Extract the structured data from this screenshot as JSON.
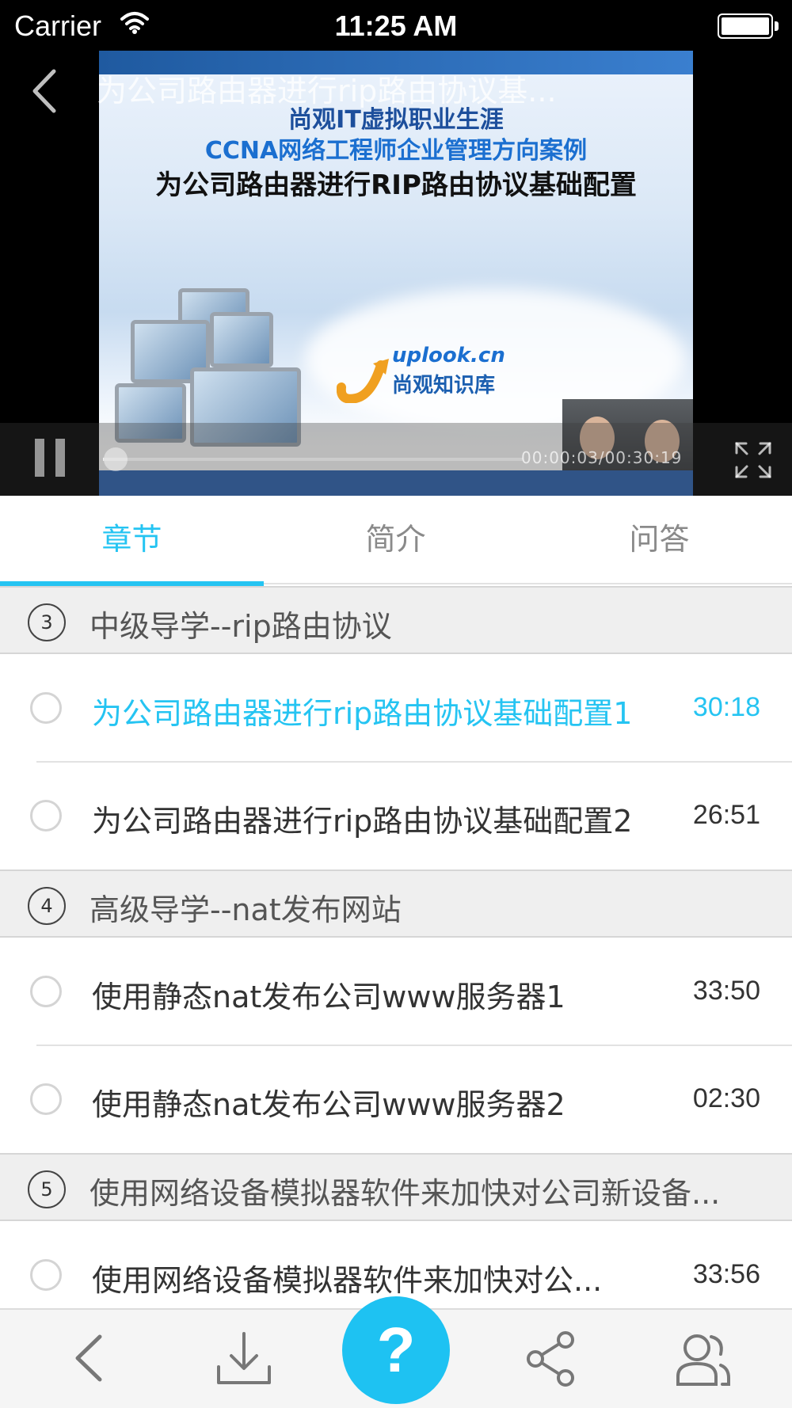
{
  "status_bar": {
    "carrier": "Carrier",
    "time": "11:25 AM"
  },
  "player": {
    "title": "为公司路由器进行rip路由协议基...",
    "frame": {
      "line1": "尚观IT虚拟职业生涯",
      "line2": "CCNA网络工程师企业管理方向案例",
      "line3": "为公司路由器进行RIP路由协议基础配置",
      "logo_line1": "uplook.cn",
      "logo_line2": "尚观知识库"
    },
    "time_display": "00:00:03/00:30:19",
    "progress_fraction": 0.002
  },
  "tabs": [
    {
      "label": "章节",
      "active": true
    },
    {
      "label": "简介",
      "active": false
    },
    {
      "label": "问答",
      "active": false
    }
  ],
  "sections": [
    {
      "number": "3",
      "title": "中级导学--rip路由协议",
      "lessons": [
        {
          "title": "为公司路由器进行rip路由协议基础配置1",
          "duration": "30:18",
          "active": true
        },
        {
          "title": "为公司路由器进行rip路由协议基础配置2",
          "duration": "26:51",
          "active": false
        }
      ]
    },
    {
      "number": "4",
      "title": "高级导学--nat发布网站",
      "lessons": [
        {
          "title": "使用静态nat发布公司www服务器1",
          "duration": "33:50",
          "active": false
        },
        {
          "title": "使用静态nat发布公司www服务器2",
          "duration": "02:30",
          "active": false
        }
      ]
    },
    {
      "number": "5",
      "title": "使用网络设备模拟器软件来加快对公司新设备...",
      "lessons": [
        {
          "title": "使用网络设备模拟器软件来加快对公...",
          "duration": "33:56",
          "active": false
        }
      ]
    }
  ],
  "toolbar": {
    "help_label": "?"
  },
  "colors": {
    "accent": "#25c4f2",
    "help_button": "#1ec2f2",
    "section_bg": "#efefef"
  },
  "icons": [
    "wifi-icon",
    "battery-icon",
    "back-arrow-icon",
    "pause-icon",
    "fullscreen-icon",
    "download-icon",
    "share-icon",
    "contacts-icon"
  ]
}
